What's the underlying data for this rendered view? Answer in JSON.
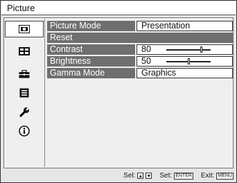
{
  "menu": {
    "title": "Picture"
  },
  "tabs": [
    {
      "name": "picture-tab",
      "selected": true
    },
    {
      "name": "signal-adjust-tab",
      "selected": false
    },
    {
      "name": "function-tab",
      "selected": false
    },
    {
      "name": "menu-settings-tab",
      "selected": false
    },
    {
      "name": "installation-tab",
      "selected": false
    },
    {
      "name": "information-tab",
      "selected": false
    }
  ],
  "items": {
    "picture_mode": {
      "label": "Picture Mode",
      "value": "Presentation"
    },
    "reset": {
      "label": "Reset"
    },
    "contrast": {
      "label": "Contrast",
      "value": "80",
      "level": 0.8
    },
    "brightness": {
      "label": "Brightness",
      "value": "50",
      "level": 0.5
    },
    "gamma_mode": {
      "label": "Gamma Mode",
      "value": "Graphics"
    }
  },
  "footer": {
    "sel_label": "Sel:",
    "set_label": "Set:",
    "set_key": "ENTER",
    "exit_label": "Exit:",
    "exit_key": "MENU",
    "up_arrow": "▲",
    "down_arrow": "▼"
  },
  "colors": {
    "highlight": "#6f6f6f",
    "background": "#e6e6e6"
  }
}
